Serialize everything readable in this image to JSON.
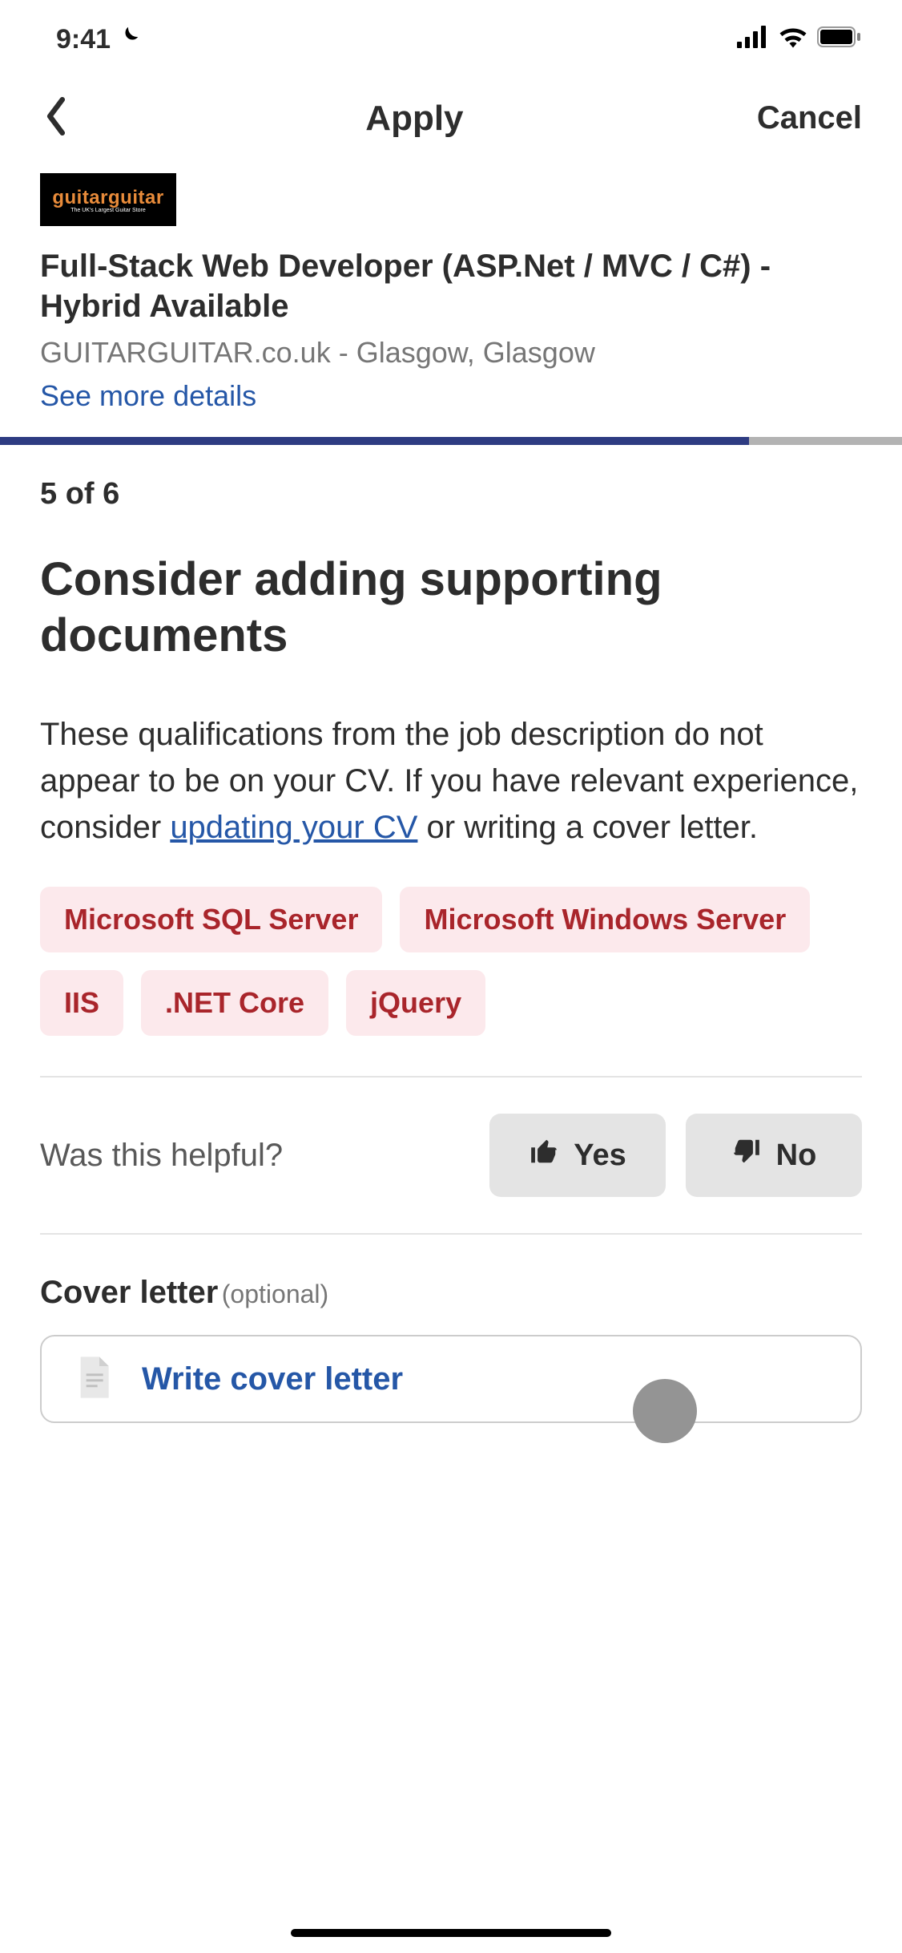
{
  "status": {
    "time": "9:41",
    "moon_icon": "moon"
  },
  "nav": {
    "title": "Apply",
    "cancel": "Cancel"
  },
  "job": {
    "logo_text": "guitarguitar",
    "logo_tagline": "The UK's Largest Guitar Store",
    "title": "Full-Stack Web Developer (ASP.Net / MVC / C#) - Hybrid Available",
    "company_location": "GUITARGUITAR.co.uk - Glasgow, Glasgow",
    "see_more": "See more details"
  },
  "progress": {
    "percent": 83,
    "step_label": "5 of 6"
  },
  "heading": "Consider adding supporting documents",
  "description": {
    "text_before": "These qualifications from the job description do not appear to be on your CV. If you have relevant experience, consider ",
    "link_text": "updating your CV",
    "text_after": " or writing a cover letter."
  },
  "skills": [
    "Microsoft SQL Server",
    "Microsoft Windows Server",
    "IIS",
    ".NET Core",
    "jQuery"
  ],
  "feedback": {
    "label": "Was this helpful?",
    "yes": "Yes",
    "no": "No"
  },
  "cover_letter": {
    "heading": "Cover letter",
    "optional": "(optional)",
    "action": "Write cover letter"
  },
  "colors": {
    "accent_blue": "#2557a7",
    "chip_bg": "#fce9ec",
    "chip_text": "#a9252b",
    "btn_bg": "#e4e4e4",
    "progress_fill": "#2e3c82"
  }
}
